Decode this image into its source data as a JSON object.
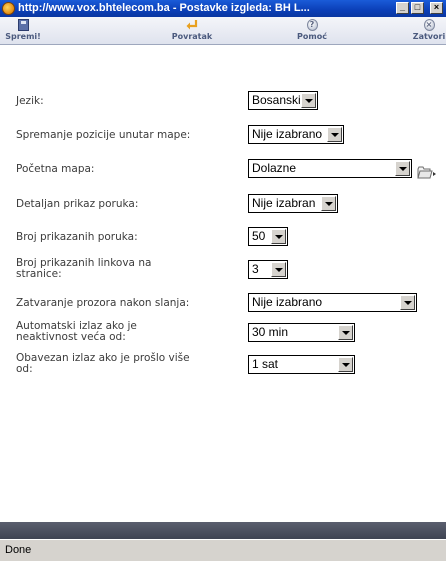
{
  "window": {
    "title": "http://www.vox.bhtelecom.ba - Postavke izgleda: BH L...",
    "min_glyph": "_",
    "max_glyph": "□",
    "close_glyph": "×"
  },
  "toolbar": {
    "save_label": "Spremi!",
    "back_label": "Povratak",
    "help_label": "Pomoć",
    "close_label": "Zatvori",
    "help_glyph": "?",
    "close_glyph": "×"
  },
  "form": {
    "language": {
      "label": "Jezik:",
      "value": "Bosanski"
    },
    "folder_position": {
      "label": "Spremanje pozicije unutar mape:",
      "value": "Nije izabrano"
    },
    "start_folder": {
      "label": "Početna mapa:",
      "value": "Dolazne"
    },
    "detailed_view": {
      "label": "Detaljan prikaz poruka:",
      "value": "Nije izabran"
    },
    "messages_count": {
      "label": "Broj prikazanih poruka:",
      "value": "50"
    },
    "links_count": {
      "label_line1": "Broj prikazanih linkova na",
      "label_line2": "stranice:",
      "value": "3"
    },
    "close_after_send": {
      "label": "Zatvaranje prozora nakon slanja:",
      "value": "Nije izabrano"
    },
    "auto_logout": {
      "label_line1": "Automatski izlaz ako je",
      "label_line2": "neaktivnost veća od:",
      "value": "30 min"
    },
    "forced_logout": {
      "label_line1": "Obavezan izlaz ako je prošlo više",
      "label_line2": "od:",
      "value": "1 sat"
    }
  },
  "status": {
    "text": "Done"
  },
  "icons": {
    "browser": "ie-globe-icon",
    "save": "floppy-disk-icon",
    "back": "return-arrow-icon",
    "help": "question-icon",
    "close": "close-circle-icon",
    "folder": "folder-icon"
  },
  "colors": {
    "titlebar": "#0b3fb7",
    "toolbar_label": "#4b5a7e",
    "back_arrow": "#e8a020",
    "status_bar": "#d6d3ce"
  }
}
